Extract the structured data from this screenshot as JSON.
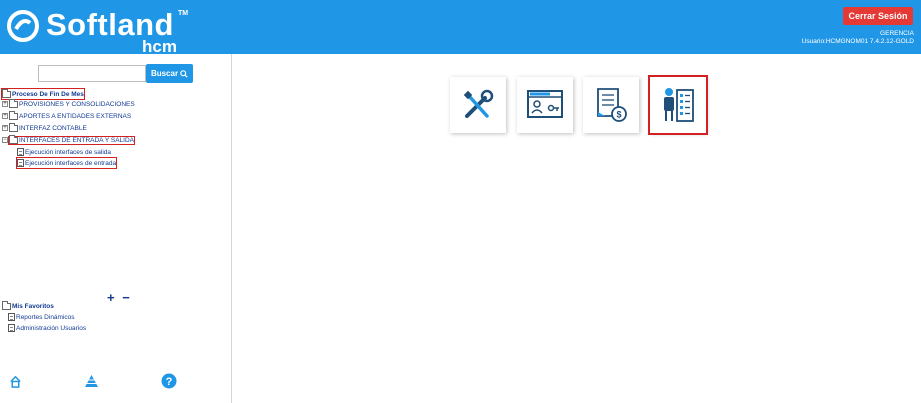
{
  "header": {
    "brand": "Softland",
    "brand_tm": "TM",
    "brand_sub": "hcm",
    "logout_label": "Cerrar Sesión",
    "user_role": "GERENCIA",
    "user_info": "Usuario:HCMGNOM01 7.4.2.12-GOLD"
  },
  "search": {
    "value": "",
    "button_label": "Buscar"
  },
  "tree": {
    "root": "Proceso De Fin De Mes",
    "items": [
      "PROVISIONES Y CONSOLIDACIONES",
      "APORTES A ENTIDADES EXTERNAS",
      "INTERFAZ CONTABLE",
      "INTERFACES DE ENTRADA Y SALIDA"
    ],
    "children": [
      "Ejecución interfaces de salida",
      "Ejecución interfaces de entrada"
    ]
  },
  "favorites": {
    "root": "Mis Favoritos",
    "items": [
      "Reportes Dinámicos",
      "Administración Usuarios"
    ]
  },
  "controls": {
    "plus_minus": "+ −"
  },
  "tiles": [
    {
      "icon": "tools-icon",
      "label": ""
    },
    {
      "icon": "web-key-icon",
      "label": ""
    },
    {
      "icon": "payroll-doc-icon",
      "label": ""
    },
    {
      "icon": "employee-list-icon",
      "label": ""
    }
  ],
  "colors": {
    "header_bg": "#1f97e6",
    "logout_bg": "#e53935",
    "highlight": "#d32020",
    "tree_text": "#123a94"
  }
}
